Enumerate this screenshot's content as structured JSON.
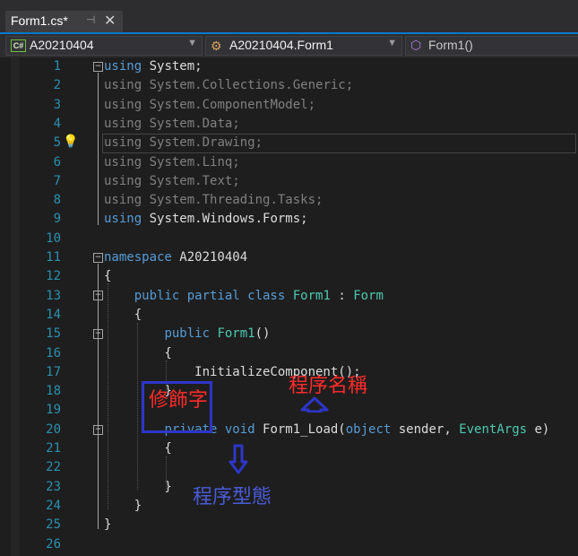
{
  "tab": {
    "title": "Form1.cs*",
    "pin_icon": "pin-icon",
    "close_glyph": "✕"
  },
  "navbar": {
    "project": "A20210404",
    "type": "A20210404.Form1",
    "member": "Form1()"
  },
  "lines": [
    {
      "n": "1",
      "tokens": [
        {
          "t": "using",
          "c": "kw"
        },
        {
          "t": " System;",
          "c": ""
        }
      ]
    },
    {
      "n": "2",
      "tokens": [
        {
          "t": "using",
          "c": "dim"
        },
        {
          "t": " System.Collections.Generic;",
          "c": "dim"
        }
      ]
    },
    {
      "n": "3",
      "tokens": [
        {
          "t": "using",
          "c": "dim"
        },
        {
          "t": " System.ComponentModel;",
          "c": "dim"
        }
      ]
    },
    {
      "n": "4",
      "tokens": [
        {
          "t": "using",
          "c": "dim"
        },
        {
          "t": " System.Data;",
          "c": "dim"
        }
      ]
    },
    {
      "n": "5",
      "tokens": [
        {
          "t": "using",
          "c": "dim"
        },
        {
          "t": " System.Drawing;",
          "c": "dim"
        }
      ]
    },
    {
      "n": "6",
      "tokens": [
        {
          "t": "using",
          "c": "dim"
        },
        {
          "t": " System.Linq;",
          "c": "dim"
        }
      ]
    },
    {
      "n": "7",
      "tokens": [
        {
          "t": "using",
          "c": "dim"
        },
        {
          "t": " System.Text;",
          "c": "dim"
        }
      ]
    },
    {
      "n": "8",
      "tokens": [
        {
          "t": "using",
          "c": "dim"
        },
        {
          "t": " System.Threading.Tasks;",
          "c": "dim"
        }
      ]
    },
    {
      "n": "9",
      "tokens": [
        {
          "t": "using",
          "c": "kw"
        },
        {
          "t": " System.Windows.Forms;",
          "c": ""
        }
      ]
    },
    {
      "n": "10",
      "tokens": []
    },
    {
      "n": "11",
      "tokens": [
        {
          "t": "namespace",
          "c": "kw"
        },
        {
          "t": " A20210404",
          "c": ""
        }
      ]
    },
    {
      "n": "12",
      "tokens": [
        {
          "t": "{",
          "c": ""
        }
      ]
    },
    {
      "n": "13",
      "tokens": [
        {
          "t": "    ",
          "c": ""
        },
        {
          "t": "public partial class",
          "c": "kw"
        },
        {
          "t": " ",
          "c": ""
        },
        {
          "t": "Form1",
          "c": "ty"
        },
        {
          "t": " : ",
          "c": ""
        },
        {
          "t": "Form",
          "c": "ty"
        }
      ]
    },
    {
      "n": "14",
      "tokens": [
        {
          "t": "    {",
          "c": ""
        }
      ]
    },
    {
      "n": "15",
      "tokens": [
        {
          "t": "        ",
          "c": ""
        },
        {
          "t": "public",
          "c": "kw"
        },
        {
          "t": " ",
          "c": ""
        },
        {
          "t": "Form1",
          "c": "ty"
        },
        {
          "t": "()",
          "c": ""
        }
      ]
    },
    {
      "n": "16",
      "tokens": [
        {
          "t": "        {",
          "c": ""
        }
      ]
    },
    {
      "n": "17",
      "tokens": [
        {
          "t": "            InitializeComponent();",
          "c": ""
        }
      ]
    },
    {
      "n": "18",
      "tokens": [
        {
          "t": "        }",
          "c": ""
        }
      ]
    },
    {
      "n": "19",
      "tokens": []
    },
    {
      "n": "20",
      "tokens": [
        {
          "t": "        ",
          "c": ""
        },
        {
          "t": "private void",
          "c": "kw"
        },
        {
          "t": " Form1_Load(",
          "c": ""
        },
        {
          "t": "object",
          "c": "kw"
        },
        {
          "t": " sender, ",
          "c": ""
        },
        {
          "t": "EventArgs",
          "c": "ty"
        },
        {
          "t": " e)",
          "c": ""
        }
      ]
    },
    {
      "n": "21",
      "tokens": [
        {
          "t": "        {",
          "c": ""
        }
      ]
    },
    {
      "n": "22",
      "tokens": []
    },
    {
      "n": "23",
      "tokens": [
        {
          "t": "        }",
          "c": ""
        }
      ]
    },
    {
      "n": "24",
      "tokens": [
        {
          "t": "    }",
          "c": ""
        }
      ]
    },
    {
      "n": "25",
      "tokens": [
        {
          "t": "}",
          "c": ""
        }
      ]
    },
    {
      "n": "26",
      "tokens": []
    }
  ],
  "annotations": {
    "modifier": "修飾字",
    "method_name": "程序名稱",
    "return_type": "程序型態"
  },
  "colors": {
    "keyword": "#569cd6",
    "type": "#4ec9b0",
    "line_number": "#2b91af",
    "annotation_red": "#ff2a2a",
    "annotation_blue": "#2e36c8"
  }
}
